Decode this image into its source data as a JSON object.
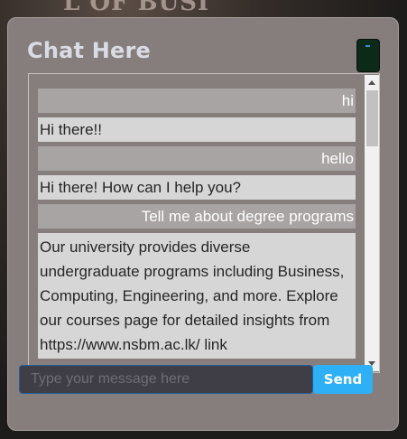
{
  "background": {
    "text": "L OF BUSI"
  },
  "chat": {
    "title": "Chat Here",
    "close_icon": "close-icon",
    "messages": [
      {
        "sender": "user",
        "text": "hi"
      },
      {
        "sender": "bot",
        "text": "Hi there!!"
      },
      {
        "sender": "user",
        "text": "hello"
      },
      {
        "sender": "bot",
        "text": "Hi there! How can I help you?"
      },
      {
        "sender": "user",
        "text": "Tell me about degree programs"
      },
      {
        "sender": "bot",
        "text": "Our university provides diverse undergraduate programs including Business, Computing, Engineering, and more. Explore our courses page for detailed insights from https://www.nsbm.ac.lk/ link"
      }
    ]
  },
  "input": {
    "placeholder": "Type your message here",
    "value": ""
  },
  "send": {
    "label": "Send"
  },
  "colors": {
    "panel": "#867e7c",
    "send": "#2db0f5",
    "user_bubble": "#a8a4a4",
    "bot_bubble": "#d6d6d6"
  }
}
